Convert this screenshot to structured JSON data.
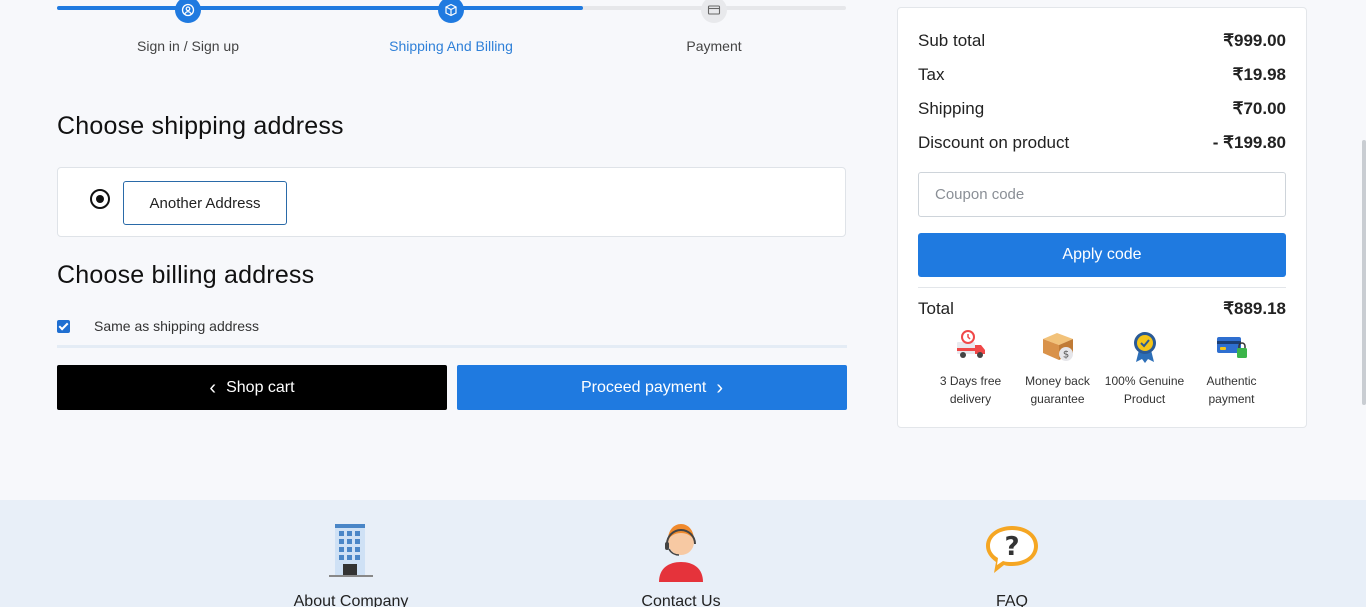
{
  "stepper": {
    "steps": [
      {
        "label": "Sign in / Sign up",
        "icon": "user-circle-icon",
        "state": "done"
      },
      {
        "label": "Shipping And Billing",
        "icon": "box-icon",
        "state": "current"
      },
      {
        "label": "Payment",
        "icon": "card-icon",
        "state": "todo"
      }
    ]
  },
  "shipping": {
    "title": "Choose shipping address",
    "address_button": "Another Address"
  },
  "billing": {
    "title": "Choose billing address",
    "same_as_shipping_label": "Same as shipping address",
    "same_as_shipping_checked": true
  },
  "actions": {
    "shop_cart": "Shop cart",
    "proceed": "Proceed payment"
  },
  "summary": {
    "rows": [
      {
        "label": "Sub total",
        "value": "₹999.00"
      },
      {
        "label": "Tax",
        "value": "₹19.98"
      },
      {
        "label": "Shipping",
        "value": "₹70.00"
      },
      {
        "label": "Discount on product",
        "value": "- ₹199.80"
      }
    ],
    "coupon_placeholder": "Coupon code",
    "apply_label": "Apply code",
    "total_label": "Total",
    "total_value": "₹889.18",
    "features": [
      {
        "icon": "delivery-truck-icon",
        "line1": "3 Days free",
        "line2": "delivery"
      },
      {
        "icon": "money-box-icon",
        "line1": "Money back",
        "line2": "guarantee"
      },
      {
        "icon": "genuine-badge-icon",
        "line1": "100% Genuine",
        "line2": "Product"
      },
      {
        "icon": "secure-card-icon",
        "line1": "Authentic",
        "line2": "payment"
      }
    ]
  },
  "footer": {
    "items": [
      {
        "label": "About Company",
        "icon": "building-icon"
      },
      {
        "label": "Contact Us",
        "icon": "support-agent-icon"
      },
      {
        "label": "FAQ",
        "icon": "question-bubble-icon"
      }
    ]
  },
  "colors": {
    "primary": "#1f7ae0",
    "dark_button": "#000000",
    "footer_bg": "#e8eff8"
  }
}
